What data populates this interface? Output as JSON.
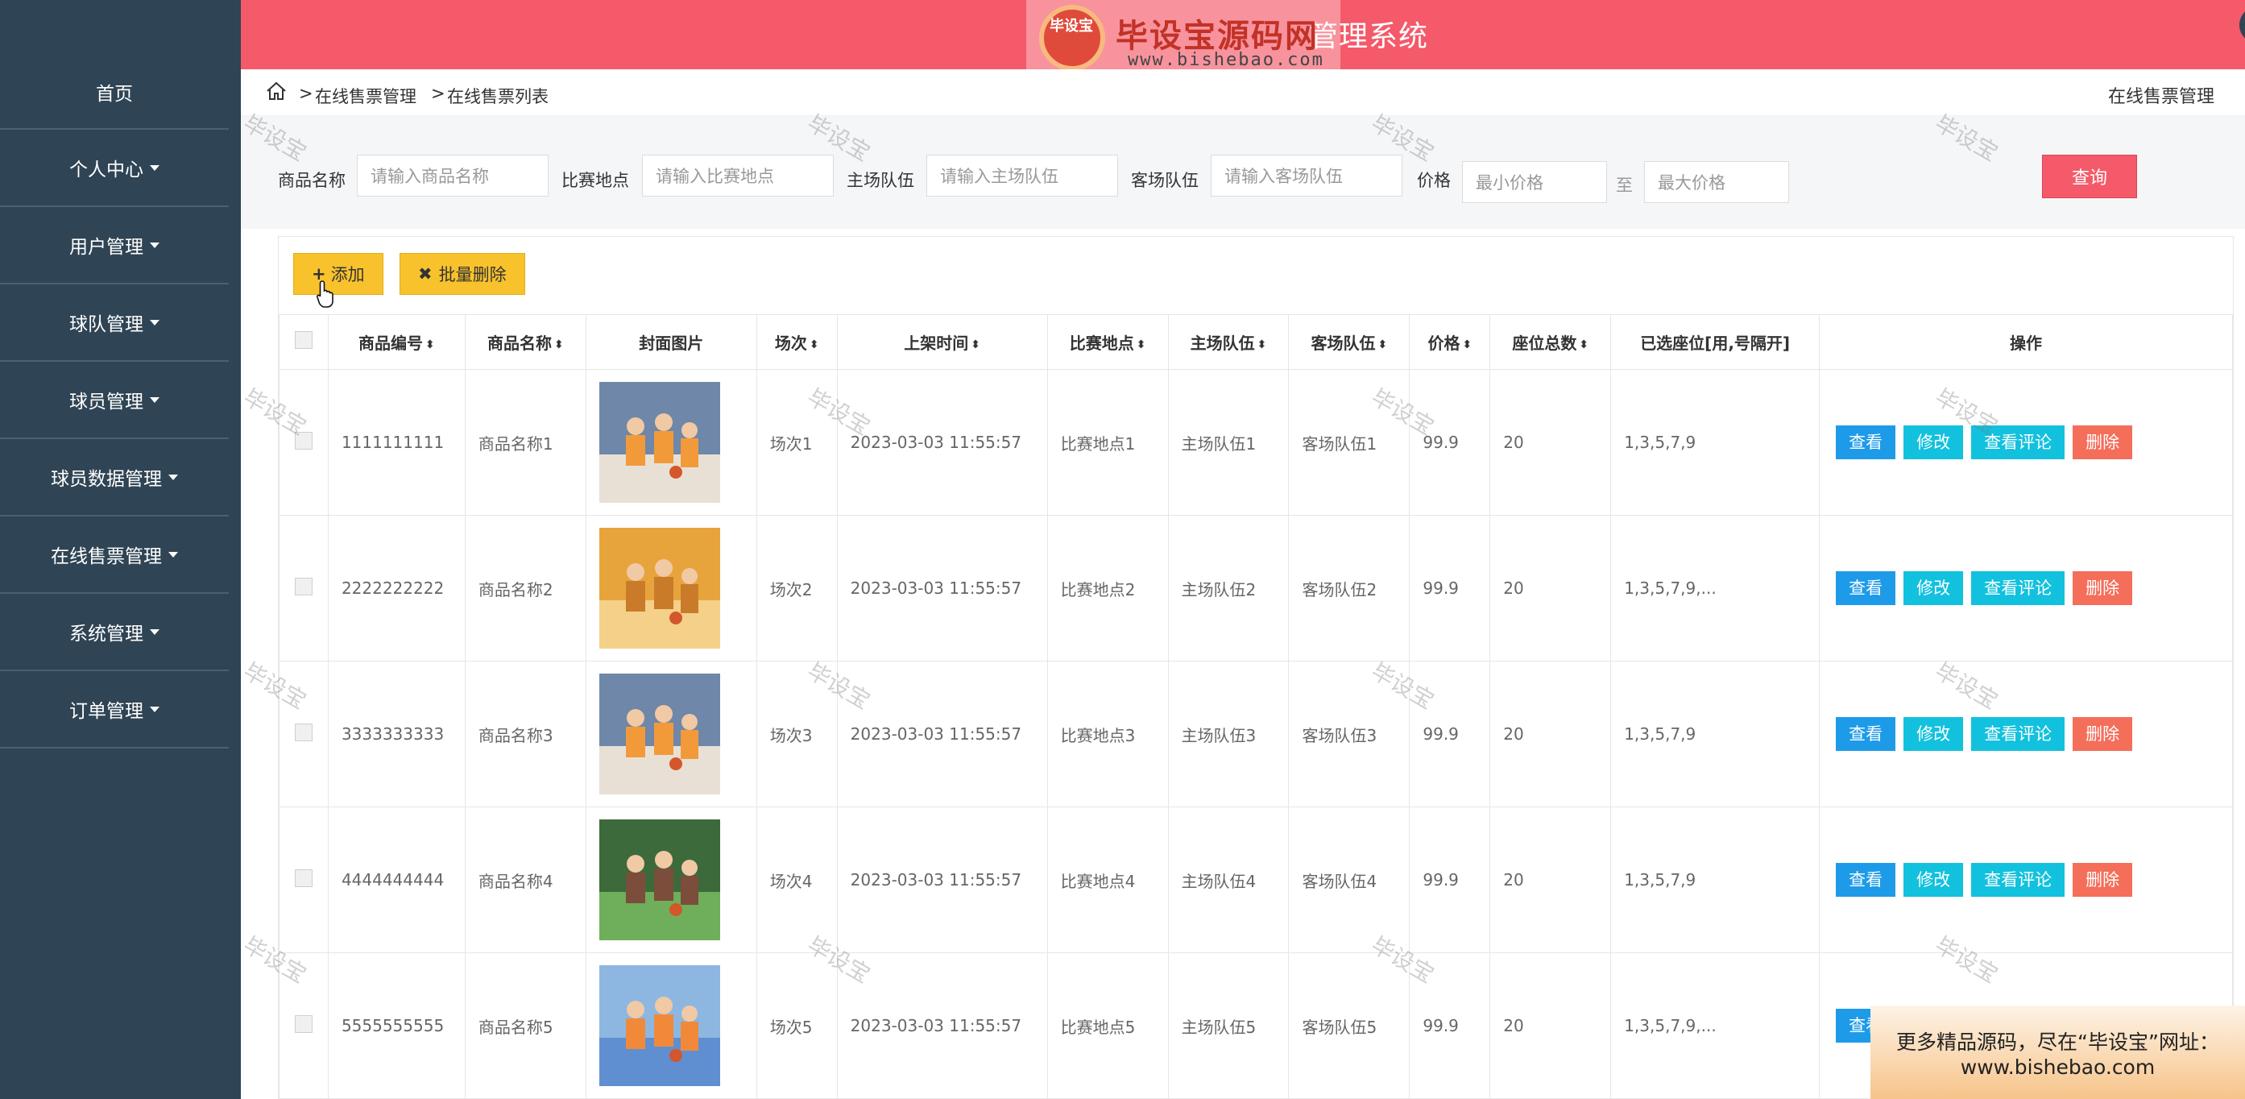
{
  "sidebar": {
    "items": [
      {
        "label": "首页",
        "caret": false
      },
      {
        "label": "个人中心",
        "caret": true
      },
      {
        "label": "用户管理",
        "caret": true
      },
      {
        "label": "球队管理",
        "caret": true
      },
      {
        "label": "球员管理",
        "caret": true
      },
      {
        "label": "球员数据管理",
        "caret": true
      },
      {
        "label": "在线售票管理",
        "caret": true
      },
      {
        "label": "系统管理",
        "caret": true
      },
      {
        "label": "订单管理",
        "caret": true
      }
    ]
  },
  "header": {
    "title": "管理系统",
    "watermark_main": "毕设宝源码网",
    "watermark_sub": "www.bishebao.com",
    "watermark_badge": "毕设宝"
  },
  "breadcrumb": {
    "sep": ">",
    "level1": "在线售票管理",
    "level2": "在线售票列表",
    "right_title": "在线售票管理"
  },
  "search": {
    "name_label": "商品名称",
    "name_placeholder": "请输入商品名称",
    "venue_label": "比赛地点",
    "venue_placeholder": "请输入比赛地点",
    "home_label": "主场队伍",
    "home_placeholder": "请输入主场队伍",
    "away_label": "客场队伍",
    "away_placeholder": "请输入客场队伍",
    "price_label": "价格",
    "min_placeholder": "最小价格",
    "to_label": "至",
    "max_placeholder": "最大价格",
    "query_button": "查询"
  },
  "toolbar": {
    "add_label": "添加",
    "batch_delete_label": "批量删除"
  },
  "table": {
    "columns": [
      "商品编号",
      "商品名称",
      "封面图片",
      "场次",
      "上架时间",
      "比赛地点",
      "主场队伍",
      "客场队伍",
      "价格",
      "座位总数",
      "已选座位[用,号隔开]",
      "操作"
    ],
    "sortable": [
      true,
      true,
      false,
      true,
      true,
      true,
      true,
      true,
      true,
      true,
      false,
      false
    ],
    "rows": [
      {
        "id": "1111111111",
        "name": "商品名称1",
        "session": "场次1",
        "time": "2023-03-03 11:55:57",
        "venue": "比赛地点1",
        "home": "主场队伍1",
        "away": "客场队伍1",
        "price": "99.9",
        "seats": "20",
        "selected": "1,3,5,7,9",
        "img": "orange-team-1"
      },
      {
        "id": "2222222222",
        "name": "商品名称2",
        "session": "场次2",
        "time": "2023-03-03 11:55:57",
        "venue": "比赛地点2",
        "home": "主场队伍2",
        "away": "客场队伍2",
        "price": "99.9",
        "seats": "20",
        "selected": "1,3,5,7,9,...",
        "img": "gym-yellow"
      },
      {
        "id": "3333333333",
        "name": "商品名称3",
        "session": "场次3",
        "time": "2023-03-03 11:55:57",
        "venue": "比赛地点3",
        "home": "主场队伍3",
        "away": "客场队伍3",
        "price": "99.9",
        "seats": "20",
        "selected": "1,3,5,7,9",
        "img": "orange-team-1"
      },
      {
        "id": "4444444444",
        "name": "商品名称4",
        "session": "场次4",
        "time": "2023-03-03 11:55:57",
        "venue": "比赛地点4",
        "home": "主场队伍4",
        "away": "客场队伍4",
        "price": "99.9",
        "seats": "20",
        "selected": "1,3,5,7,9",
        "img": "green-court"
      },
      {
        "id": "5555555555",
        "name": "商品名称5",
        "session": "场次5",
        "time": "2023-03-03 11:55:57",
        "venue": "比赛地点5",
        "home": "主场队伍5",
        "away": "客场队伍5",
        "price": "99.9",
        "seats": "20",
        "selected": "1,3,5,7,9,...",
        "img": "blue-court"
      }
    ],
    "actions": {
      "view": "查看",
      "edit": "修改",
      "comments": "查看评论",
      "delete": "删除"
    }
  },
  "watermark": "毕设宝",
  "promo": {
    "line1": "更多精品源码，尽在“毕设宝”网址：",
    "line2": "www.bishebao.com"
  },
  "colors": {
    "sidebar": "#2f4454",
    "header": "#f45a6a",
    "yellow_button": "#f8c22c",
    "view": "#1e9be8",
    "edit": "#12c1de",
    "delete": "#f46e5a"
  }
}
